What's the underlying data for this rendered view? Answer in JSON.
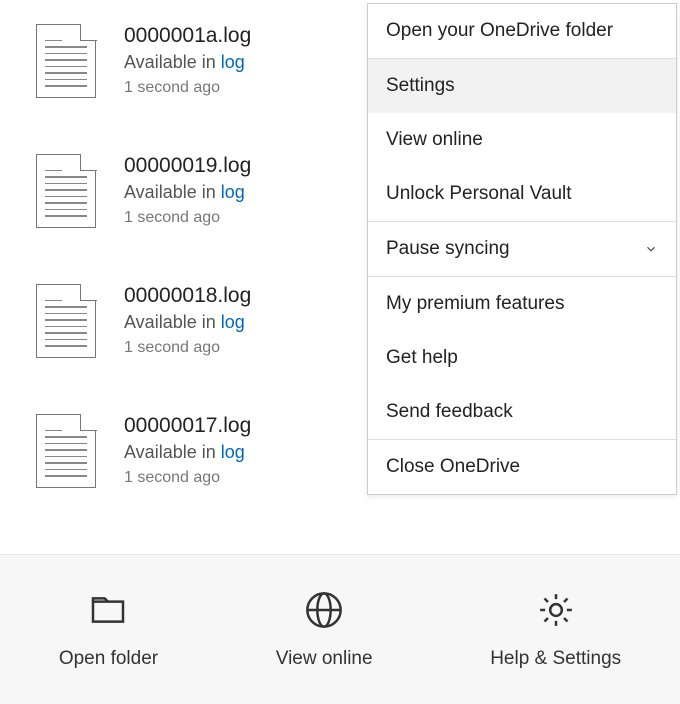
{
  "files": [
    {
      "name": "0000001a.log",
      "status_prefix": "Available in ",
      "status_link": "log",
      "time": "1 second ago"
    },
    {
      "name": "00000019.log",
      "status_prefix": "Available in ",
      "status_link": "log",
      "time": "1 second ago"
    },
    {
      "name": "00000018.log",
      "status_prefix": "Available in ",
      "status_link": "log",
      "time": "1 second ago"
    },
    {
      "name": "00000017.log",
      "status_prefix": "Available in ",
      "status_link": "log",
      "time": "1 second ago"
    }
  ],
  "menu": {
    "open_folder": "Open your OneDrive folder",
    "settings": "Settings",
    "view_online": "View online",
    "unlock_vault": "Unlock Personal Vault",
    "pause_syncing": "Pause syncing",
    "premium": "My premium features",
    "get_help": "Get help",
    "send_feedback": "Send feedback",
    "close": "Close OneDrive"
  },
  "bottom": {
    "open_folder": "Open folder",
    "view_online": "View online",
    "help_settings": "Help & Settings"
  }
}
